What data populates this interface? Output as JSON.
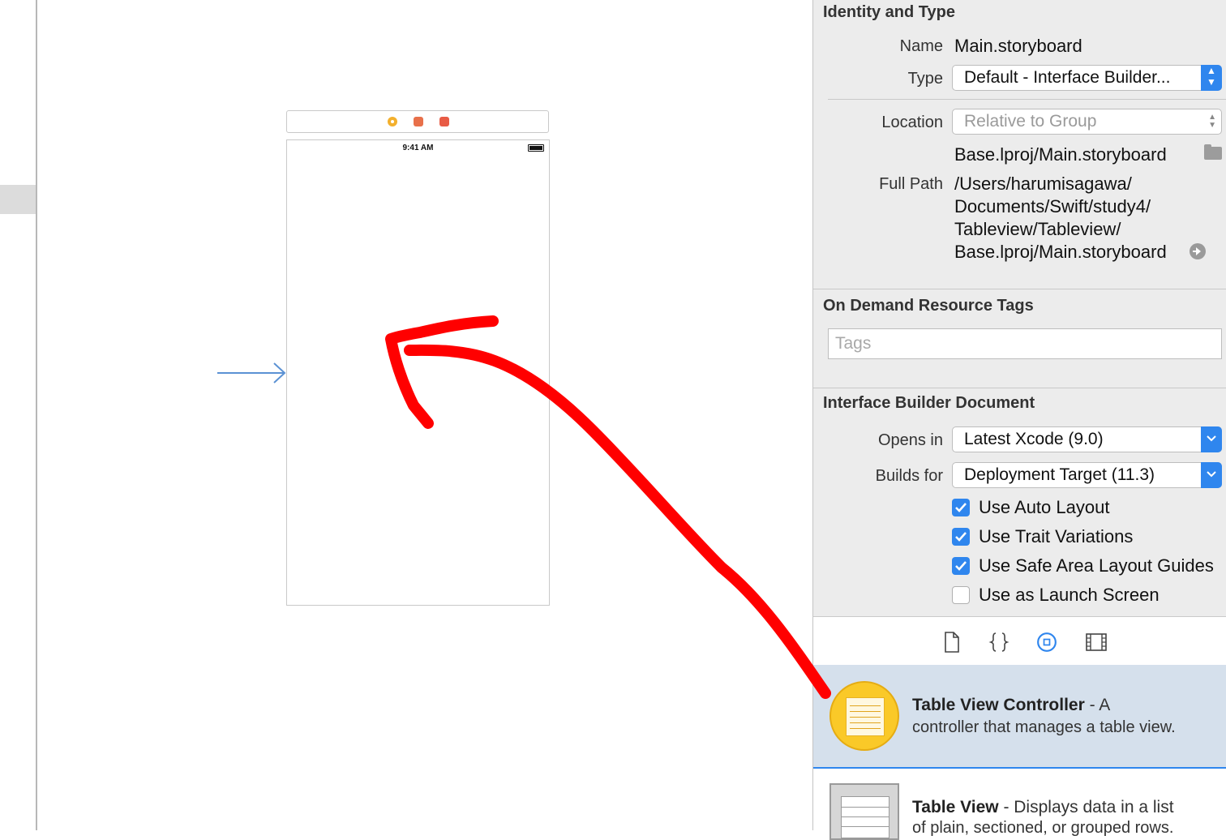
{
  "canvas": {
    "status_time": "9:41 AM"
  },
  "identity": {
    "title": "Identity and Type",
    "name_label": "Name",
    "name_value": "Main.storyboard",
    "type_label": "Type",
    "type_value": "Default - Interface Builder...",
    "location_label": "Location",
    "location_value": "Relative to Group",
    "location_file": "Base.lproj/Main.storyboard",
    "fullpath_label": "Full Path",
    "fullpath_lines": [
      "/Users/harumisagawa/",
      "Documents/Swift/study4/",
      "Tableview/Tableview/",
      "Base.lproj/Main.storyboard"
    ]
  },
  "odr": {
    "title": "On Demand Resource Tags",
    "tags_placeholder": "Tags"
  },
  "ibdoc": {
    "title": "Interface Builder Document",
    "opens_in_label": "Opens in",
    "opens_in_value": "Latest Xcode (9.0)",
    "builds_for_label": "Builds for",
    "builds_for_value": "Deployment Target (11.3)",
    "options": [
      {
        "label": "Use Auto Layout",
        "checked": true
      },
      {
        "label": "Use Trait Variations",
        "checked": true
      },
      {
        "label": "Use Safe Area Layout Guides",
        "checked": true
      },
      {
        "label": "Use as Launch Screen",
        "checked": false
      }
    ]
  },
  "library_tabs": [
    "file-template-icon",
    "code-snippet-icon",
    "object-library-icon",
    "media-library-icon"
  ],
  "library": {
    "items": [
      {
        "name": "Table View Controller",
        "sep": " - A",
        "desc": "controller that manages a table view."
      },
      {
        "name": "Table View",
        "sep": " - Displays data in a list",
        "desc": "of plain, sectioned, or grouped rows."
      }
    ]
  },
  "colors": {
    "accent": "#2f86ee",
    "annotation": "#ff0000",
    "selection": "#d5e0ec"
  }
}
